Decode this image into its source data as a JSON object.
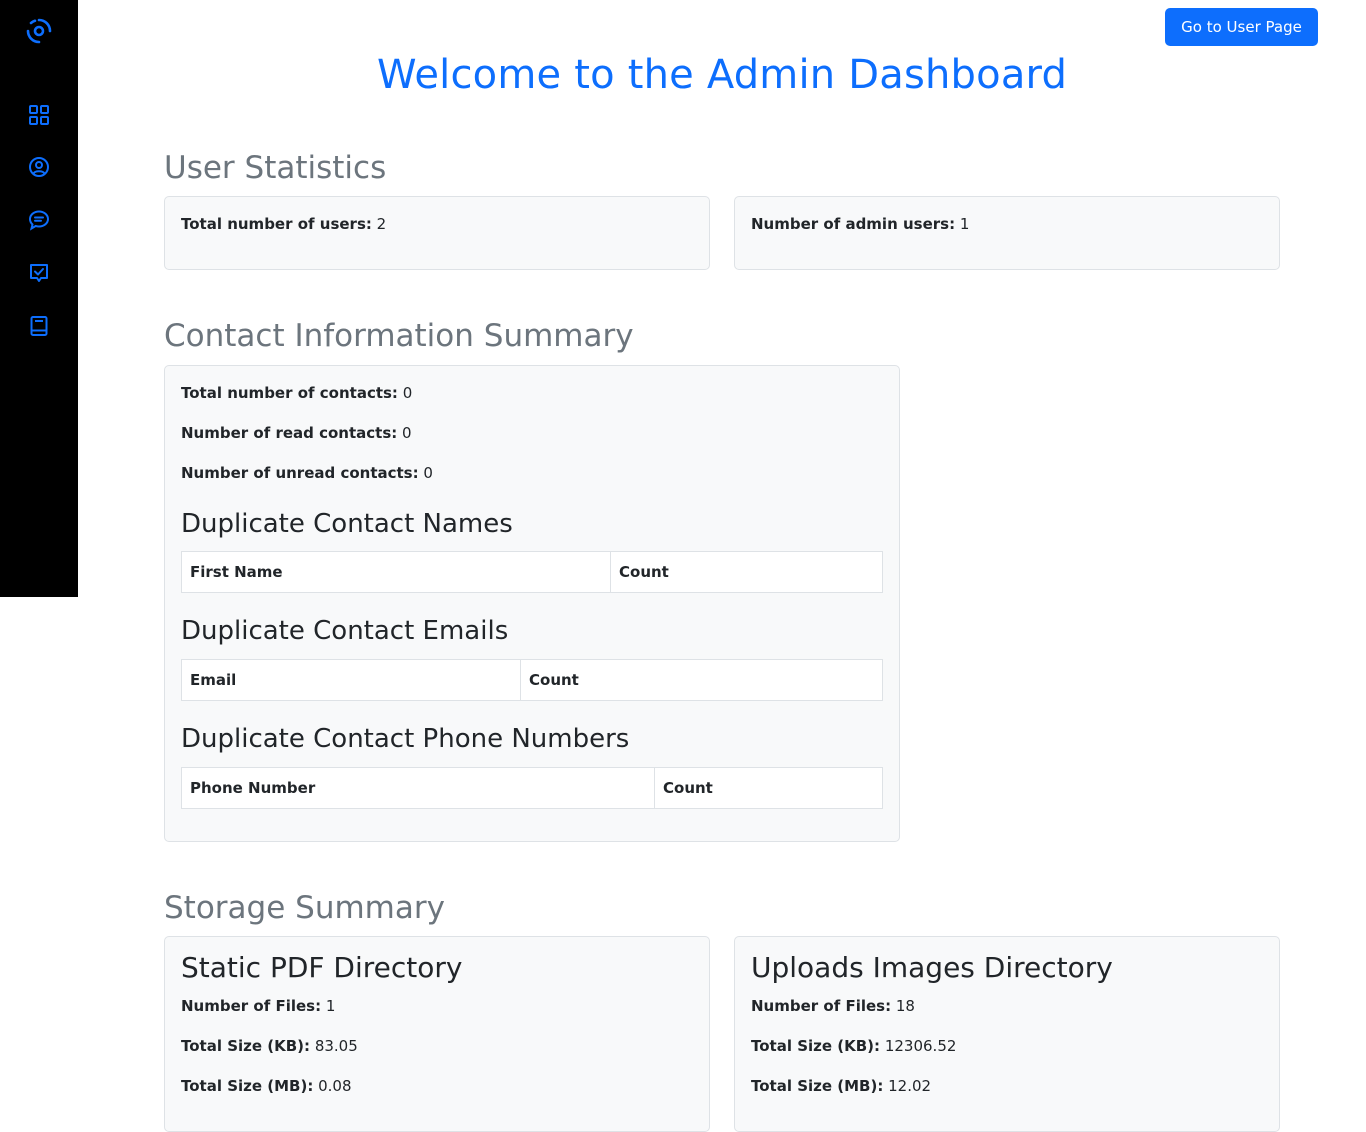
{
  "sidebar": {
    "icons": [
      "app-logo-icon",
      "dashboard-grid-icon",
      "user-circle-icon",
      "chat-bubble-icon",
      "checklist-icon",
      "book-icon"
    ],
    "icon_color": "#0d6efd",
    "background": "#000000"
  },
  "header": {
    "user_page_button": "Go to User Page",
    "title": "Welcome to the Admin Dashboard"
  },
  "user_statistics": {
    "title": "User Statistics",
    "total_label": "Total number of users:",
    "total_value": "2",
    "admin_label": "Number of admin users:",
    "admin_value": "1"
  },
  "contact_summary": {
    "title": "Contact Information Summary",
    "total_label": "Total number of contacts:",
    "total_value": "0",
    "read_label": "Number of read contacts:",
    "read_value": "0",
    "unread_label": "Number of unread contacts:",
    "unread_value": "0",
    "dup_names": {
      "title": "Duplicate Contact Names",
      "columns": [
        "First Name",
        "Count"
      ]
    },
    "dup_emails": {
      "title": "Duplicate Contact Emails",
      "columns": [
        "Email",
        "Count"
      ]
    },
    "dup_phones": {
      "title": "Duplicate Contact Phone Numbers",
      "columns": [
        "Phone Number",
        "Count"
      ]
    }
  },
  "storage_summary": {
    "title": "Storage Summary",
    "pdf": {
      "title": "Static PDF Directory",
      "files_label": "Number of Files:",
      "files_value": "1",
      "kb_label": "Total Size (KB):",
      "kb_value": "83.05",
      "mb_label": "Total Size (MB):",
      "mb_value": "0.08"
    },
    "images": {
      "title": "Uploads Images Directory",
      "files_label": "Number of Files:",
      "files_value": "18",
      "kb_label": "Total Size (KB):",
      "kb_value": "12306.52",
      "mb_label": "Total Size (MB):",
      "mb_value": "12.02"
    }
  },
  "colors": {
    "accent": "#0d6efd",
    "muted_heading": "#6c757d",
    "card_bg": "#f8f9fa"
  }
}
